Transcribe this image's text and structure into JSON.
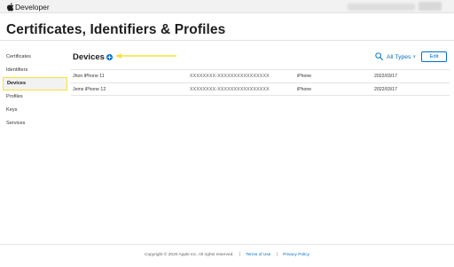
{
  "header": {
    "brand_label": "Developer"
  },
  "page": {
    "title": "Certificates, Identifiers & Profiles"
  },
  "sidebar": {
    "items": [
      {
        "label": "Certificates",
        "active": false
      },
      {
        "label": "Identifiers",
        "active": false
      },
      {
        "label": "Devices",
        "active": true
      },
      {
        "label": "Profiles",
        "active": false
      },
      {
        "label": "Keys",
        "active": false
      },
      {
        "label": "Services",
        "active": false
      }
    ]
  },
  "section": {
    "title": "Devices",
    "filter_label": "All Types",
    "edit_label": "Edit"
  },
  "devices": {
    "rows": [
      {
        "name": "Jhon iPhone 11",
        "udid": "XXXXXXXX-XXXXXXXXXXXXXXXX",
        "model": "iPhone",
        "date": "2022/03/17"
      },
      {
        "name": "Jems iPhone 12",
        "udid": "XXXXXXXX-XXXXXXXXXXXXXXXX",
        "model": "iPhone",
        "date": "2022/03/17"
      }
    ]
  },
  "footer": {
    "copyright": "Copyright © 2020 Apple Inc. All rights reserved.",
    "terms_label": "Terms of Use",
    "privacy_label": "Privacy Policy"
  },
  "colors": {
    "link_blue": "#0070c9",
    "highlight_yellow": "#f5e13a",
    "title_text": "#1d1d1f"
  },
  "icons": {
    "brand": "apple-logo-icon",
    "add": "plus-circle-icon",
    "search": "search-icon",
    "filter_chevron": "chevron-down-icon",
    "annotation": "arrow-left-icon"
  }
}
